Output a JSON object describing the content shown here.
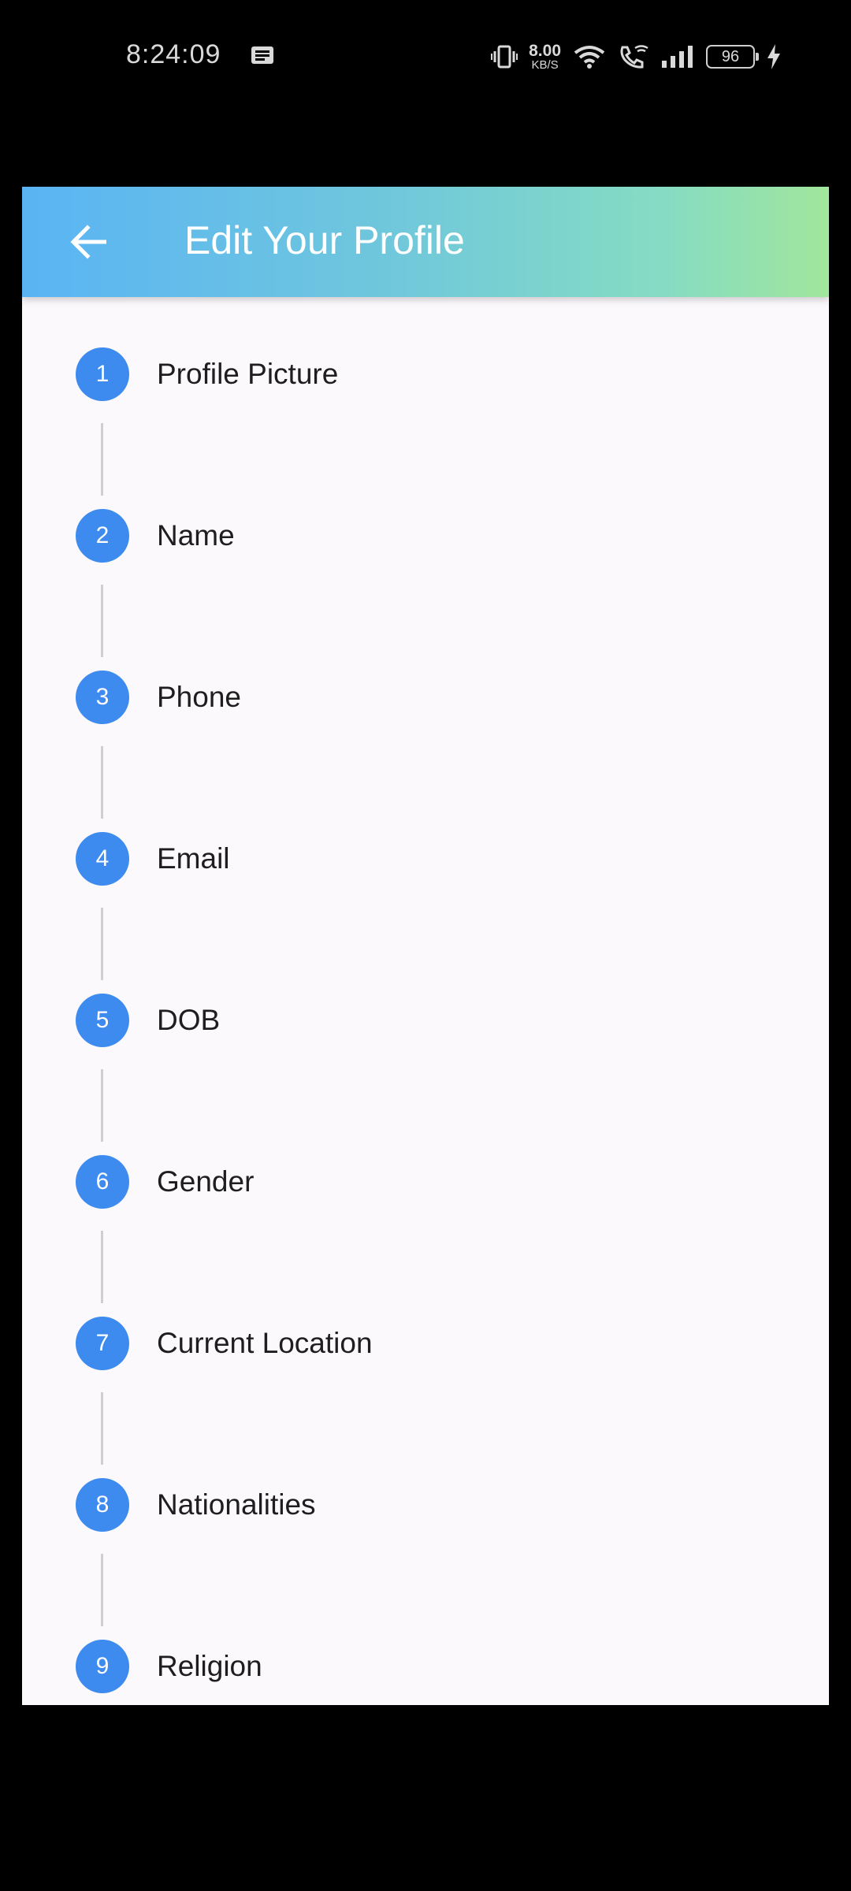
{
  "status_bar": {
    "time": "8:24:09",
    "net_speed_value": "8.00",
    "net_speed_unit": "KB/S",
    "battery_level": "96",
    "icons": [
      "message-icon",
      "vibrate-icon",
      "wifi-icon",
      "wifi-calling-icon",
      "signal-icon",
      "battery-icon",
      "charging-icon"
    ]
  },
  "app_bar": {
    "back_icon": "arrow-left-icon",
    "title": "Edit Your Profile",
    "gradient_colors": [
      "#5ab4f4",
      "#a1e69c"
    ]
  },
  "steps": [
    {
      "number": "1",
      "label": "Profile Picture"
    },
    {
      "number": "2",
      "label": "Name"
    },
    {
      "number": "3",
      "label": "Phone"
    },
    {
      "number": "4",
      "label": "Email"
    },
    {
      "number": "5",
      "label": "DOB"
    },
    {
      "number": "6",
      "label": "Gender"
    },
    {
      "number": "7",
      "label": "Current Location"
    },
    {
      "number": "8",
      "label": "Nationalities"
    },
    {
      "number": "9",
      "label": "Religion"
    }
  ],
  "colors": {
    "step_circle": "#3e8bf0",
    "connector": "#cfcfcf",
    "background": "#fbf9fc"
  }
}
